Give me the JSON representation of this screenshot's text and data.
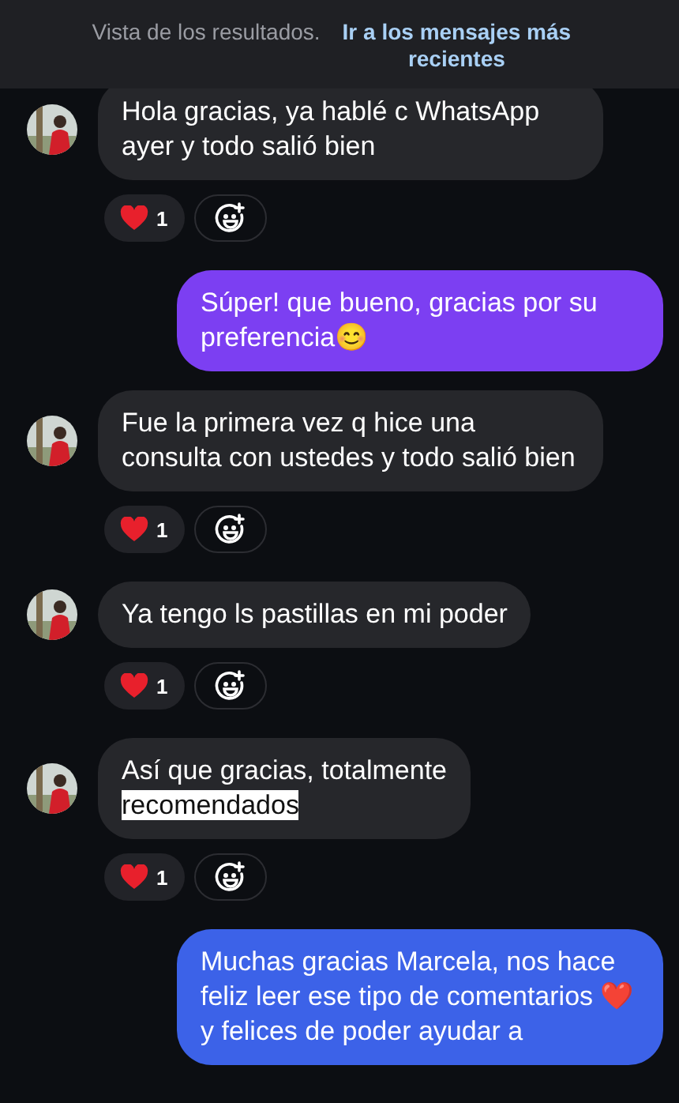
{
  "banner": {
    "text": "Vista de los resultados.",
    "link": "Ir a los mensajes más recientes"
  },
  "messages": [
    {
      "kind": "received",
      "parts": [
        {
          "text": "Hola gracias, ya hablé c WhatsApp ayer y todo salió bien",
          "highlighted": false
        }
      ],
      "reaction": {
        "count": "1"
      }
    },
    {
      "kind": "sent",
      "color": "#7c3ff2",
      "parts": [
        {
          "text": "Súper! que bueno, gracias por su preferencia😊",
          "highlighted": false
        }
      ]
    },
    {
      "kind": "received",
      "parts": [
        {
          "text": "Fue la primera vez q hice una consulta con ustedes y todo salió bien",
          "highlighted": false
        }
      ],
      "reaction": {
        "count": "1"
      }
    },
    {
      "kind": "received",
      "parts": [
        {
          "text": "Ya tengo ls pastillas en mi poder",
          "highlighted": false
        }
      ],
      "reaction": {
        "count": "1"
      }
    },
    {
      "kind": "received",
      "parts": [
        {
          "text": "Así que gracias, totalmente",
          "highlighted": false
        },
        {
          "text": "recomendados",
          "highlighted": true
        }
      ],
      "reaction": {
        "count": "1"
      }
    },
    {
      "kind": "sent",
      "color": "#3c62e8",
      "parts": [
        {
          "text": "Muchas gracias Marcela, nos hace feliz leer ese tipo de comentarios ❤️ y felices de poder ayudar a",
          "highlighted": false
        }
      ]
    }
  ]
}
